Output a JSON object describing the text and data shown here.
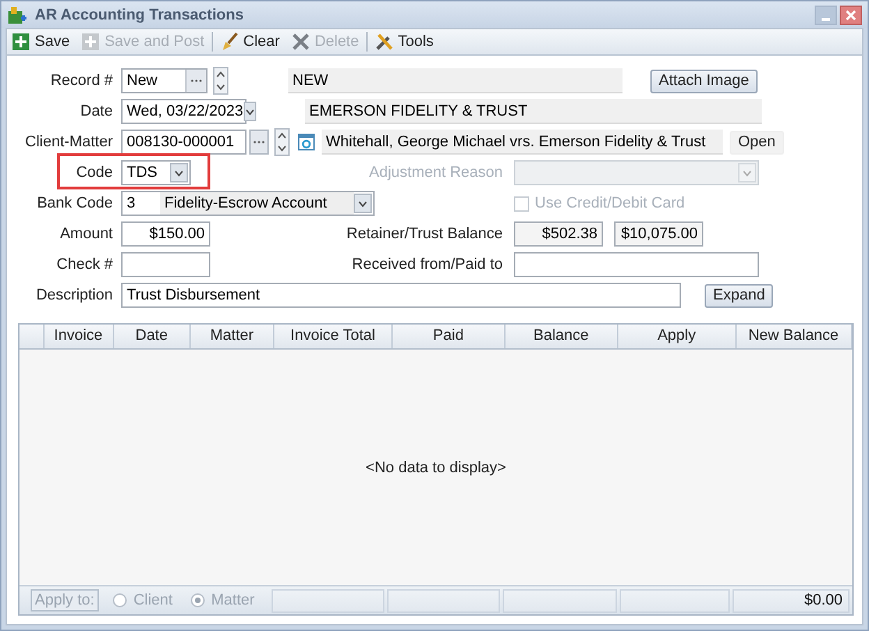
{
  "window": {
    "title": "AR Accounting Transactions"
  },
  "toolbar": [
    {
      "label": "Save",
      "disabled": false
    },
    {
      "label": "Save and Post",
      "disabled": true
    },
    {
      "label": "Clear",
      "disabled": false
    },
    {
      "label": "Delete",
      "disabled": true
    },
    {
      "label": "Tools",
      "disabled": false
    }
  ],
  "form": {
    "record": {
      "label": "Record #",
      "value": "New",
      "name": "NEW",
      "attach_button": "Attach Image"
    },
    "date": {
      "label": "Date",
      "value": "Wed, 03/22/2023",
      "client": "EMERSON FIDELITY & TRUST"
    },
    "client_matter": {
      "label": "Client-Matter",
      "value": "008130-000001",
      "matter": "Whitehall, George Michael vrs. Emerson Fidelity & Trust",
      "open_button": "Open"
    },
    "code": {
      "label": "Code",
      "value": "TDS",
      "highlighted": true
    },
    "adjustment_reason": {
      "label": "Adjustment Reason",
      "disabled": true
    },
    "bank_code": {
      "label": "Bank Code",
      "number": "3",
      "name": "Fidelity-Escrow Account"
    },
    "use_card": {
      "label": "Use Credit/Debit Card",
      "checked": false,
      "disabled": true
    },
    "amount": {
      "label": "Amount",
      "value": "$150.00"
    },
    "balance": {
      "label": "Retainer/Trust Balance",
      "retainer": "$502.38",
      "trust": "$10,075.00"
    },
    "check": {
      "label": "Check #"
    },
    "received": {
      "label": "Received from/Paid to"
    },
    "description": {
      "label": "Description",
      "value": "Trust Disbursement",
      "expand_button": "Expand"
    }
  },
  "table": {
    "columns": [
      "Invoice",
      "Date",
      "Matter",
      "Invoice Total",
      "Paid",
      "Balance",
      "Apply",
      "New Balance"
    ],
    "empty_text": "<No data to display>"
  },
  "footer": {
    "apply_button": {
      "label": "Apply to:",
      "disabled": true
    },
    "options": [
      {
        "label": "Client",
        "selected": false
      },
      {
        "label": "Matter",
        "selected": true
      }
    ],
    "total": "$0.00"
  }
}
